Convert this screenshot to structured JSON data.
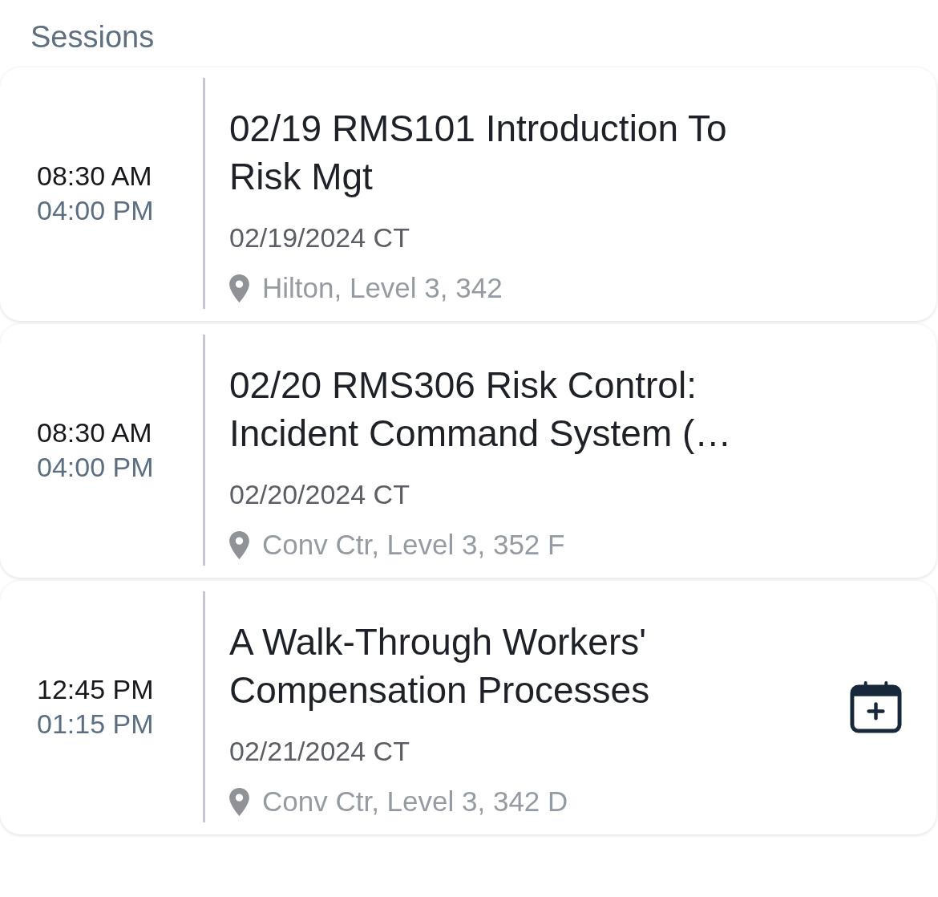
{
  "header": {
    "title": "Sessions"
  },
  "sessions": [
    {
      "start_time": "08:30 AM",
      "end_time": "04:00 PM",
      "title": "02/19 RMS101 Introduction To Risk Mgt",
      "date": "02/19/2024 CT",
      "location": "Hilton, Level 3, 342",
      "calendar_button": false
    },
    {
      "start_time": "08:30 AM",
      "end_time": "04:00 PM",
      "title": "02/20 RMS306 Risk Control: Incident Command System (…",
      "date": "02/20/2024 CT",
      "location": "Conv Ctr, Level 3, 352 F",
      "calendar_button": false
    },
    {
      "start_time": "12:45 PM",
      "end_time": "01:15 PM",
      "title": "A Walk-Through Workers' Compensation Processes",
      "date": "02/21/2024 CT",
      "location": "Conv Ctr, Level 3, 342 D",
      "calendar_button": true
    }
  ]
}
